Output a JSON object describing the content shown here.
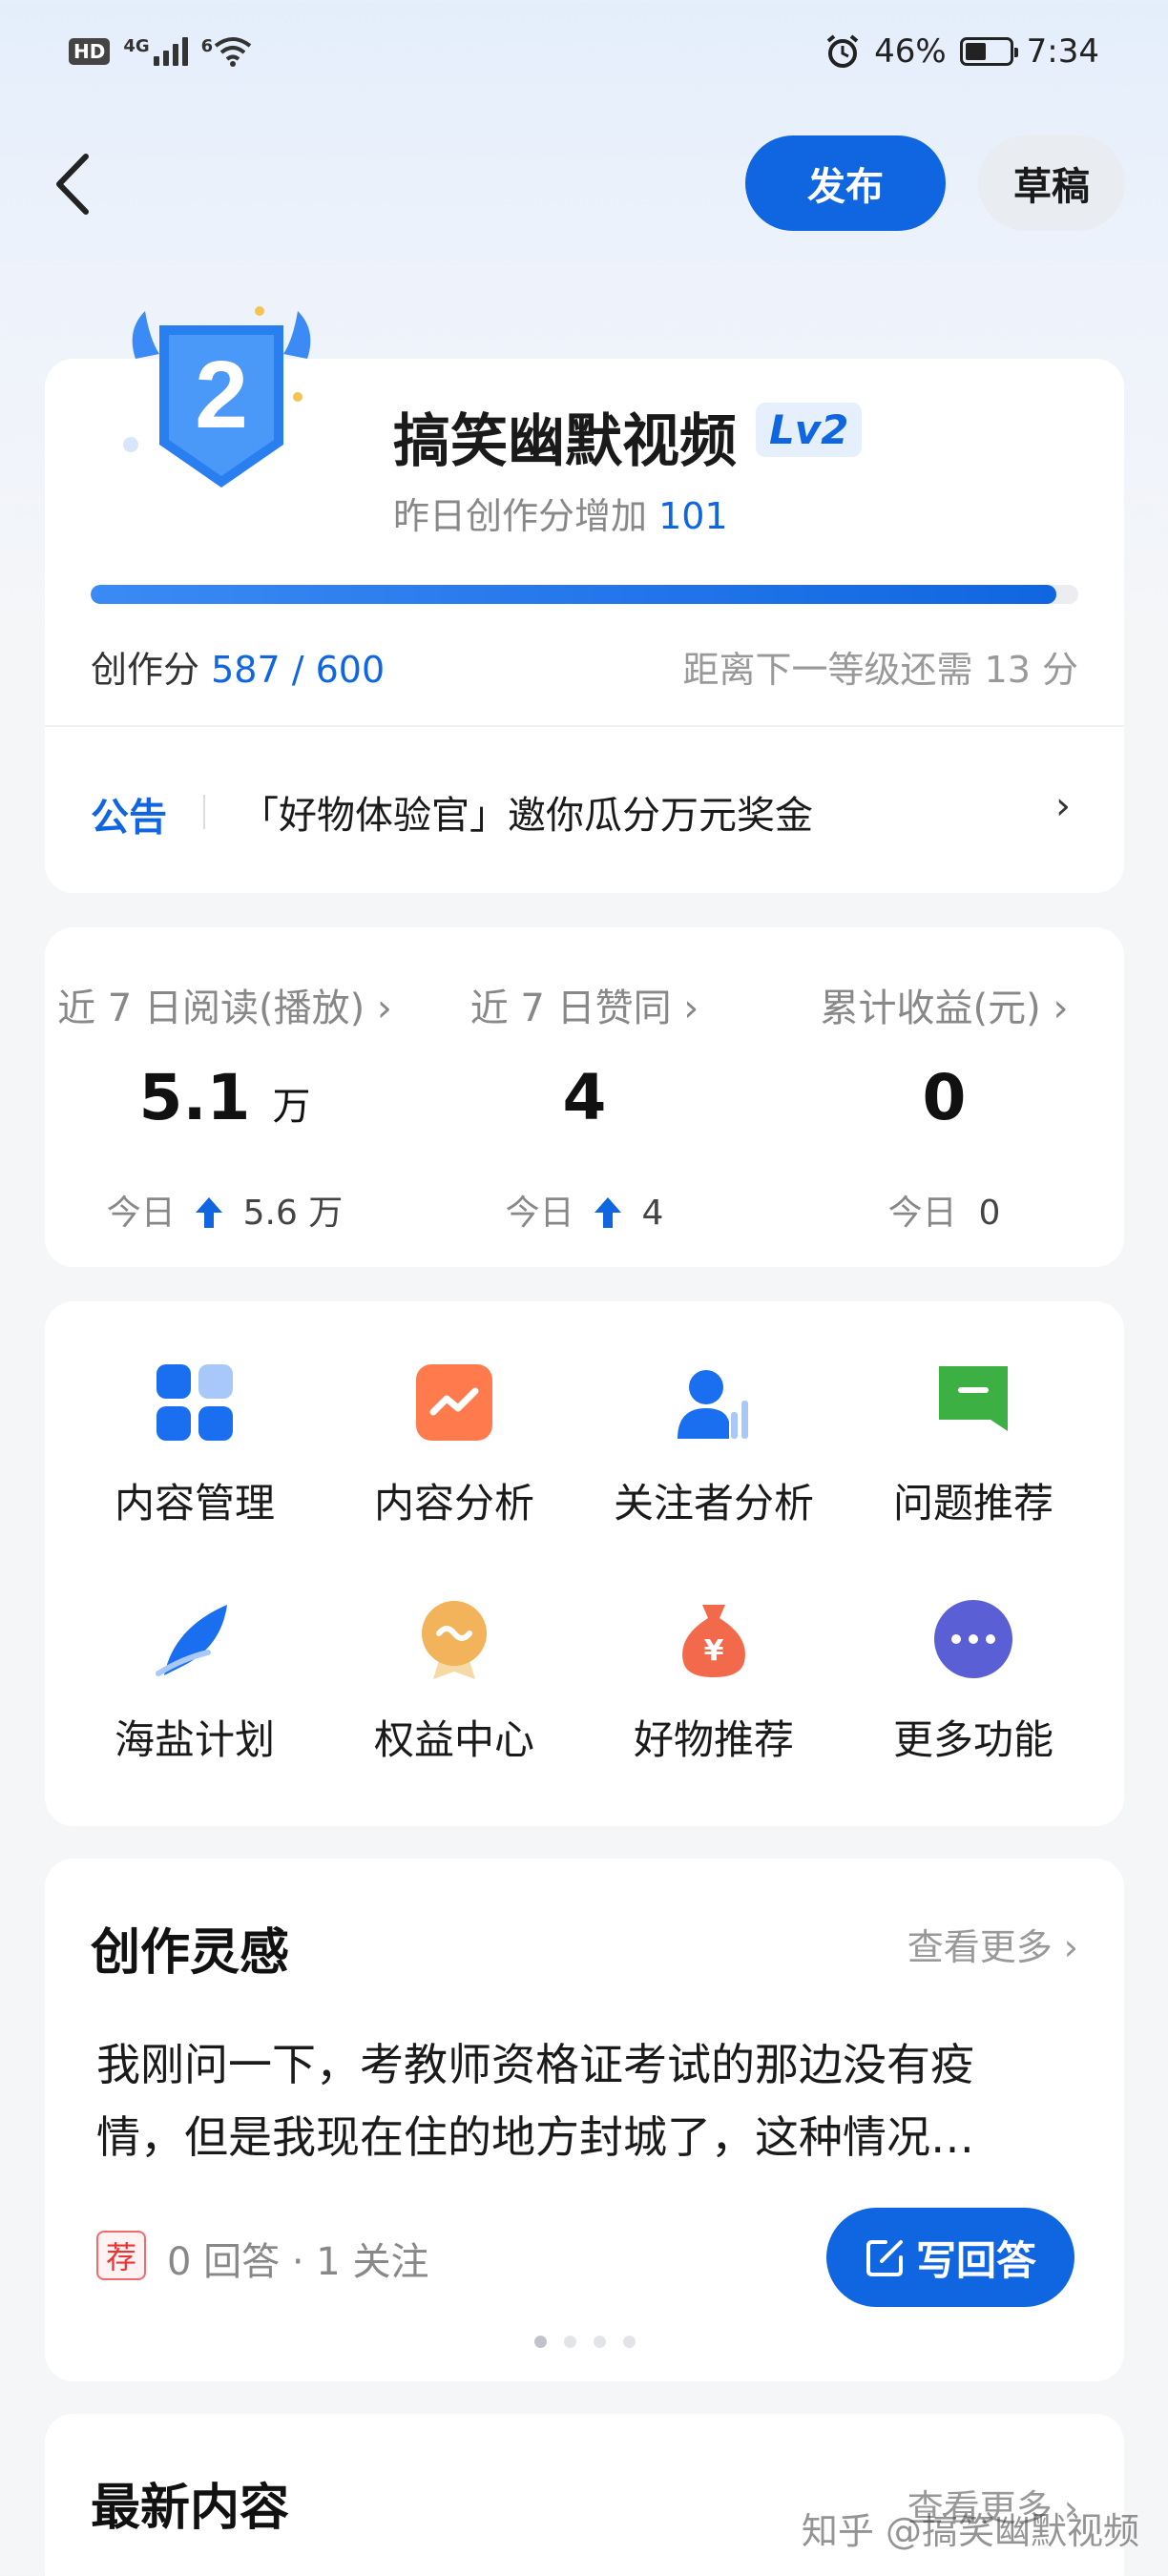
{
  "status_bar": {
    "hd": "HD",
    "network": "4G",
    "wifi_badge": "6",
    "battery_percent": "46%",
    "time": "7:34",
    "battery_level": 0.46
  },
  "header": {
    "back_icon": "chevron-left-icon",
    "publish_label": "发布",
    "draft_label": "草稿"
  },
  "creator": {
    "badge_number": "2",
    "name": "搞笑幽默视频",
    "level": "Lv2",
    "yesterday_label": "昨日创作分增加",
    "yesterday_value": "101",
    "score_label": "创作分",
    "score_value": "587 / 600",
    "progress": 0.978,
    "next_level_text": "距离下一等级还需 13 分"
  },
  "notice": {
    "tag": "公告",
    "text": "「好物体验官」邀你瓜分万元奖金",
    "arrow": "›"
  },
  "stats": [
    {
      "label": "近 7 日阅读(播放) ›",
      "value": "5.1",
      "unit": "万",
      "today_label": "今日",
      "today_value": "5.6 万",
      "up": true
    },
    {
      "label": "近 7 日赞同 ›",
      "value": "4",
      "unit": "",
      "today_label": "今日",
      "today_value": "4",
      "up": true
    },
    {
      "label": "累计收益(元) ›",
      "value": "0",
      "unit": "",
      "today_label": "今日",
      "today_value": "0",
      "up": false
    }
  ],
  "functions": [
    {
      "label": "内容管理",
      "icon": "grid-icon",
      "color": "#1a6ef0"
    },
    {
      "label": "内容分析",
      "icon": "trend-chart-icon",
      "color": "#ff7a4d"
    },
    {
      "label": "关注者分析",
      "icon": "user-chart-icon",
      "color": "#1a6ef0"
    },
    {
      "label": "问题推荐",
      "icon": "question-flag-icon",
      "color": "#3cb043"
    },
    {
      "label": "海盐计划",
      "icon": "feather-icon",
      "color": "#1a6ef0"
    },
    {
      "label": "权益中心",
      "icon": "medal-icon",
      "color": "#f2b35a"
    },
    {
      "label": "好物推荐",
      "icon": "money-bag-icon",
      "color": "#f26a4b"
    },
    {
      "label": "更多功能",
      "icon": "more-dots-icon",
      "color": "#5b5fd6"
    }
  ],
  "inspiration": {
    "title": "创作灵感",
    "more_label": "查看更多 ›",
    "question_line1": "我刚问一下，考教师资格证考试的那边没有疫",
    "question_line2": "情，但是我现在住的地方封城了，这种情况…",
    "rec_tag": "荐",
    "meta": "0 回答 · 1 关注",
    "answer_label": "写回答"
  },
  "latest": {
    "title": "最新内容",
    "more_label": "查看更多 ›"
  },
  "watermark": "知乎 @搞笑幽默视频",
  "colors": {
    "accent": "#1066e0",
    "muted": "#888888"
  }
}
